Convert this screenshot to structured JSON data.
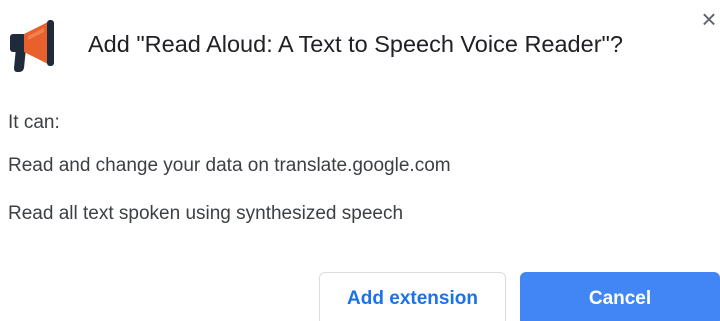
{
  "dialog": {
    "title": "Add \"Read Aloud: A Text to Speech Voice Reader\"?",
    "close_glyph": "×",
    "extension_icon": "megaphone-icon",
    "permissions_heading": "It can:",
    "permissions": [
      "Read and change your data on translate.google.com",
      "Read all text spoken using synthesized speech"
    ],
    "buttons": {
      "add_extension": "Add extension",
      "cancel": "Cancel"
    }
  },
  "colors": {
    "megaphone_body": "#e8612c",
    "megaphone_dark": "#1f2a3a",
    "primary_button": "#4285f4",
    "secondary_text": "#1a73e8"
  }
}
